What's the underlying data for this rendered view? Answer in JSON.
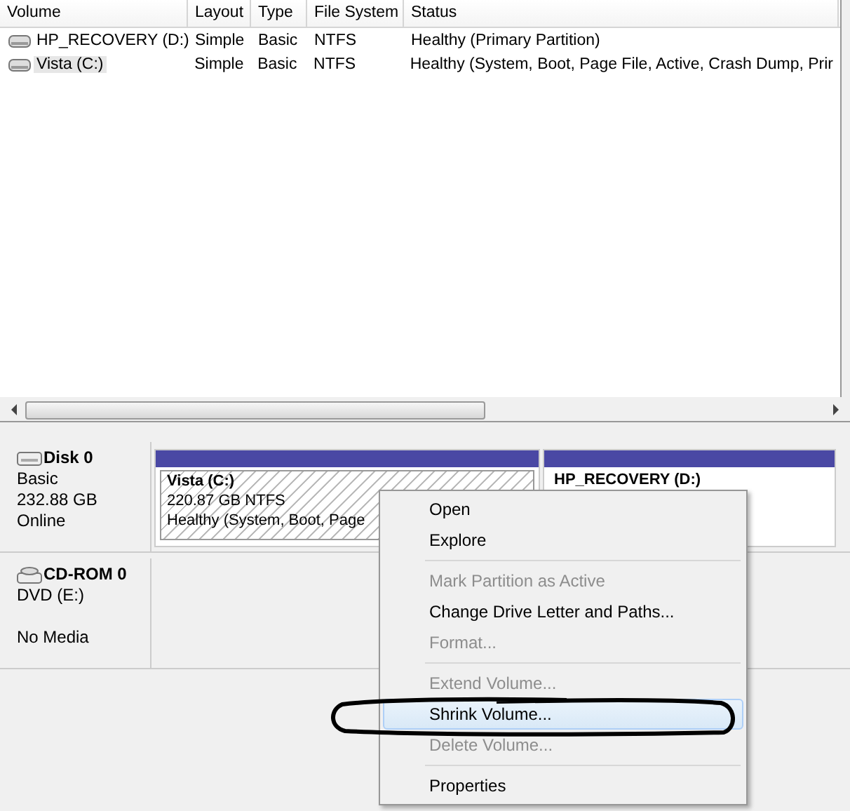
{
  "table": {
    "columns": [
      "Volume",
      "Layout",
      "Type",
      "File System",
      "Status"
    ],
    "rows": [
      {
        "cells": [
          "HP_RECOVERY (D:)",
          "Simple",
          "Basic",
          "NTFS",
          "Healthy (Primary Partition)"
        ],
        "selected": false
      },
      {
        "cells": [
          "Vista  (C:)",
          "Simple",
          "Basic",
          "NTFS",
          "Healthy (System, Boot, Page File, Active, Crash Dump, Prir"
        ],
        "selected": true
      }
    ]
  },
  "disks": [
    {
      "kind": "disk",
      "name": "Disk 0",
      "lines": [
        "Basic",
        "232.88 GB",
        "Online"
      ],
      "partitions": [
        {
          "name": "Vista  (C:)",
          "lines": [
            "220.87 GB NTFS",
            "Healthy (System, Boot, Page"
          ],
          "selected": true
        },
        {
          "name": "HP_RECOVERY  (D:)",
          "selected": false
        }
      ]
    },
    {
      "kind": "cdrom",
      "name": "CD-ROM 0",
      "lines": [
        "DVD (E:)",
        "No Media"
      ]
    }
  ],
  "context_menu": [
    {
      "kind": "item",
      "label": "Open",
      "disabled": false,
      "selected": false
    },
    {
      "kind": "item",
      "label": "Explore",
      "disabled": false,
      "selected": false
    },
    {
      "kind": "separator"
    },
    {
      "kind": "item",
      "label": "Mark Partition as Active",
      "disabled": true,
      "selected": false
    },
    {
      "kind": "item",
      "label": "Change Drive Letter and Paths...",
      "disabled": false,
      "selected": false
    },
    {
      "kind": "item",
      "label": "Format...",
      "disabled": true,
      "selected": false
    },
    {
      "kind": "separator"
    },
    {
      "kind": "item",
      "label": "Extend Volume...",
      "disabled": true,
      "selected": false
    },
    {
      "kind": "item",
      "label": "Shrink Volume...",
      "disabled": false,
      "selected": true
    },
    {
      "kind": "item",
      "label": "Delete Volume...",
      "disabled": true,
      "selected": false
    },
    {
      "kind": "separator"
    },
    {
      "kind": "item",
      "label": "Properties",
      "disabled": false,
      "selected": false
    }
  ]
}
